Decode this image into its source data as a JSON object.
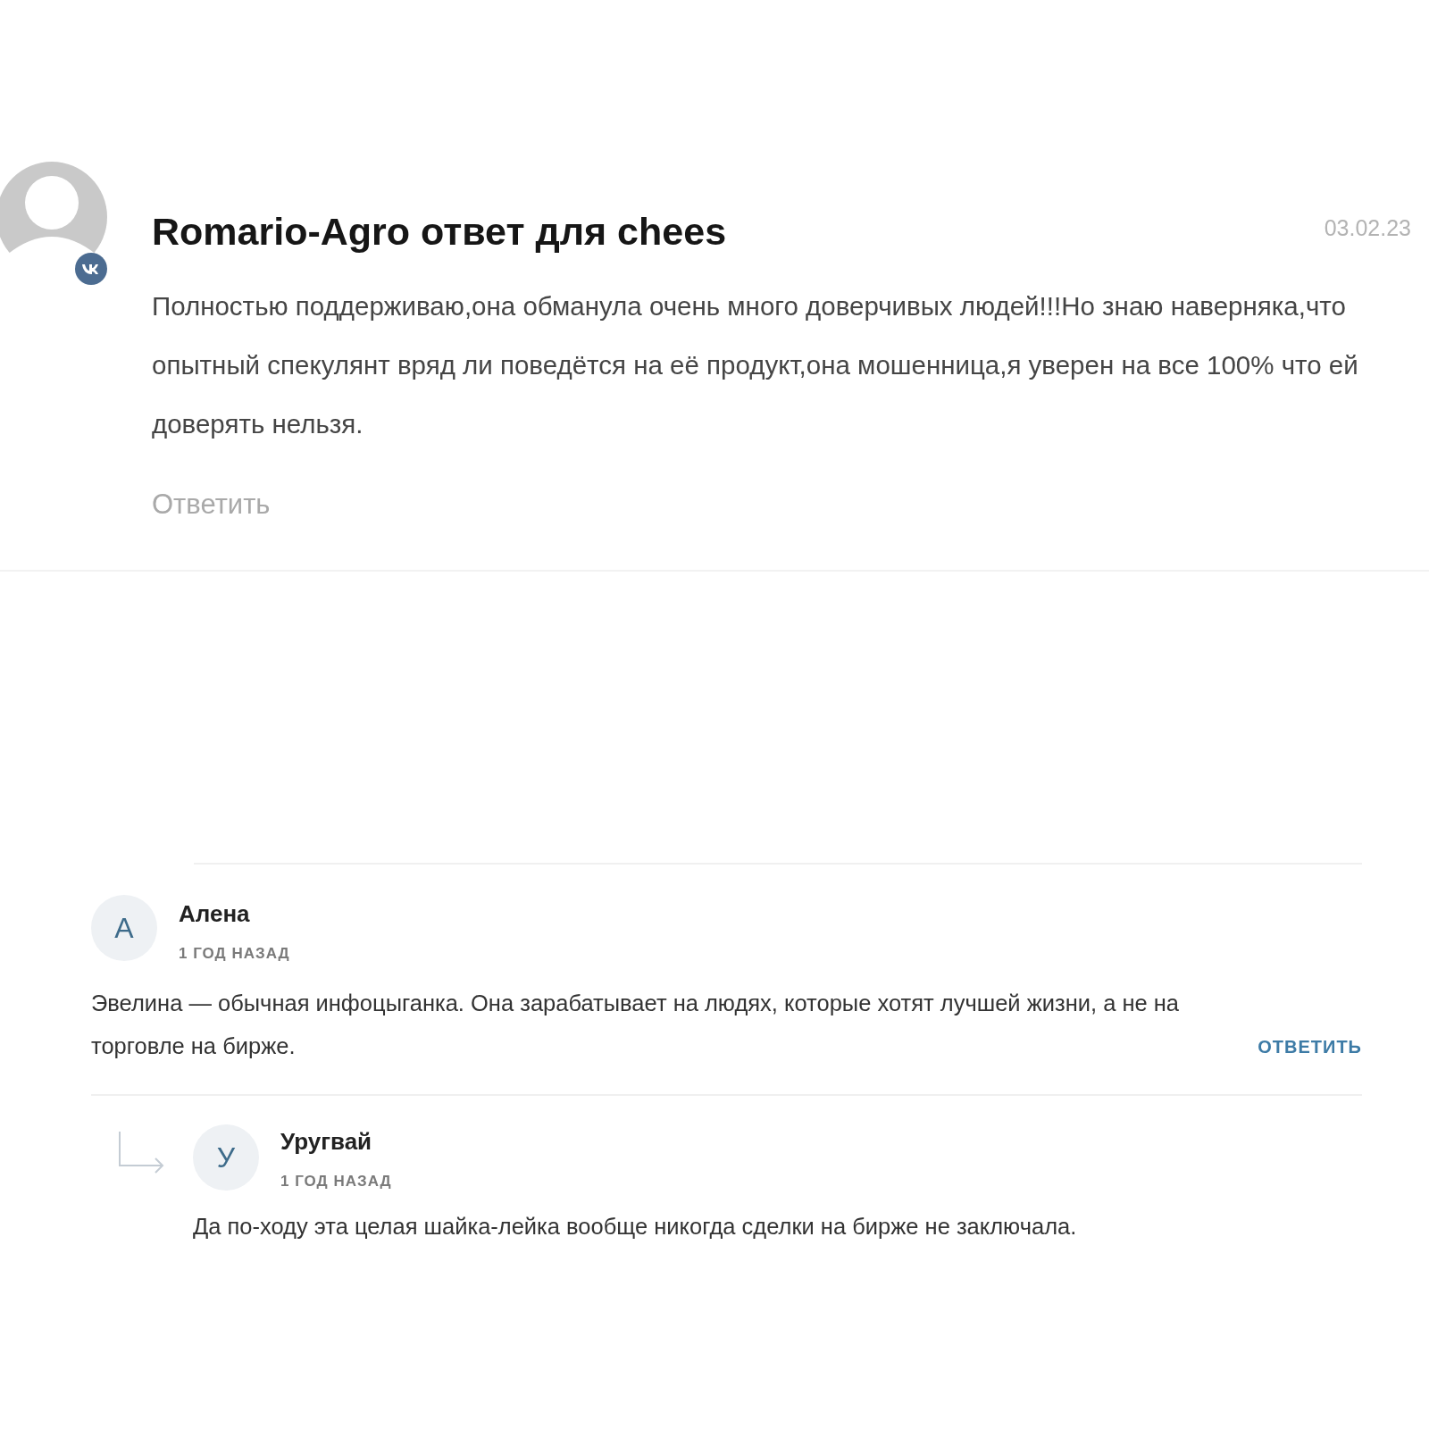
{
  "top_comment": {
    "author": "Romario-Agro ответ для chees",
    "date": "03.02.23",
    "text": "Полностью поддерживаю,она обманула очень много доверчивых людей!!!Но знаю наверняка,что опытный спекулянт вряд ли поведётся на её продукт,она мошенница,я уверен на все 100% что ей доверять нельзя.",
    "reply": "Ответить"
  },
  "comments": [
    {
      "avatar_letter": "А",
      "author": "Алена",
      "time": "1 ГОД НАЗАД",
      "text": "Эвелина — обычная инфоцыганка. Она зарабатывает на людях, которые хотят лучшей жизни, а не на торговле на бирже.",
      "reply": "ОТВЕТИТЬ",
      "replies": [
        {
          "avatar_letter": "У",
          "author": "Уругвай",
          "time": "1 ГОД НАЗАД",
          "text": "Да по-ходу эта целая шайка-лейка вообще никогда сделки на бирже не заключала."
        }
      ]
    }
  ]
}
